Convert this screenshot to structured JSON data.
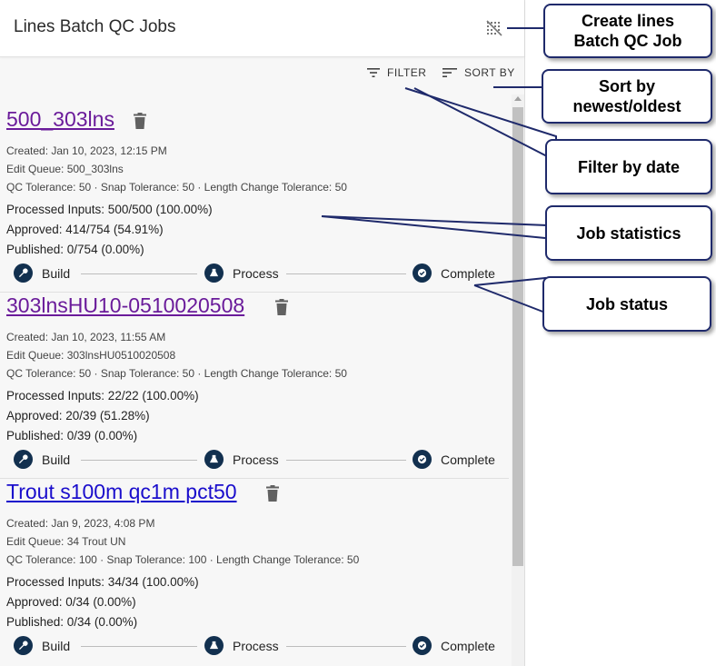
{
  "header": {
    "title": "Lines Batch QC Jobs",
    "create_icon": "grid-off-icon"
  },
  "toolbar": {
    "filter_label": "FILTER",
    "sort_label": "SORT BY"
  },
  "jobs": [
    {
      "name": "500_303lns",
      "created": "Created: Jan 10, 2023, 12:15 PM",
      "edit_queue": "Edit Queue: 500_303lns",
      "tolerances": "QC Tolerance: 50 · Snap Tolerance: 50 · Length Change Tolerance: 50",
      "processed": "Processed Inputs: 500/500 (100.00%)",
      "approved": "Approved: 414/754 (54.91%)",
      "published": "Published: 0/754 (0.00%)",
      "link_color": "#6a1b9a"
    },
    {
      "name": "303lnsHU10-0510020508 ",
      "created": "Created: Jan 10, 2023, 11:55 AM",
      "edit_queue": "Edit Queue: 303lnsHU0510020508",
      "tolerances": "QC Tolerance: 50 · Snap Tolerance: 50 · Length Change Tolerance: 50",
      "processed": "Processed Inputs: 22/22 (100.00%)",
      "approved": "Approved: 20/39 (51.28%)",
      "published": "Published: 0/39 (0.00%)",
      "link_color": "#6a1b9a"
    },
    {
      "name": "Trout s100m qc1m pct50",
      "created": "Created: Jan 9, 2023, 4:08 PM",
      "edit_queue": "Edit Queue: 34 Trout UN",
      "tolerances": "QC Tolerance: 100 · Snap Tolerance: 100 · Length Change Tolerance: 50",
      "processed": "Processed Inputs: 34/34 (100.00%)",
      "approved": "Approved: 0/34 (0.00%)",
      "published": "Published: 0/34 (0.00%)",
      "link_color": "#1a0dcc"
    }
  ],
  "steps": {
    "build": "Build",
    "process": "Process",
    "complete": "Complete"
  },
  "callouts": {
    "create": "Create lines Batch QC Job",
    "sort": "Sort by newest/oldest",
    "filter": "Filter by date",
    "stats": "Job statistics",
    "status": "Job status"
  },
  "colors": {
    "step_circle": "#12304f",
    "callout_border": "#1f2a6b"
  }
}
